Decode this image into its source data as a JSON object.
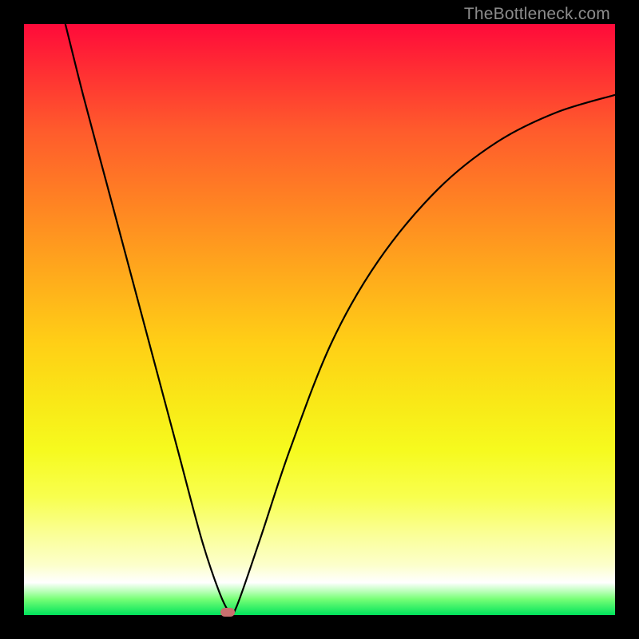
{
  "watermark": "TheBottleneck.com",
  "chart_data": {
    "type": "line",
    "title": "",
    "xlabel": "",
    "ylabel": "",
    "xlim": [
      0,
      100
    ],
    "ylim": [
      0,
      100
    ],
    "series": [
      {
        "name": "bottleneck-curve",
        "x": [
          7,
          10,
          14,
          18,
          22,
          26,
          30,
          33,
          34.8,
          36,
          40,
          45,
          52,
          60,
          70,
          80,
          90,
          100
        ],
        "y": [
          100,
          88,
          73,
          58,
          43,
          28,
          13,
          4,
          0.5,
          1.5,
          13,
          28,
          46,
          60,
          72,
          80,
          85,
          88
        ]
      }
    ],
    "marker": {
      "x": 34.5,
      "y": 0.5,
      "color": "#c96f6e"
    },
    "background_gradient": {
      "top": "#ff0a3a",
      "mid": "#ffcf16",
      "bottom": "#00e35c"
    }
  }
}
